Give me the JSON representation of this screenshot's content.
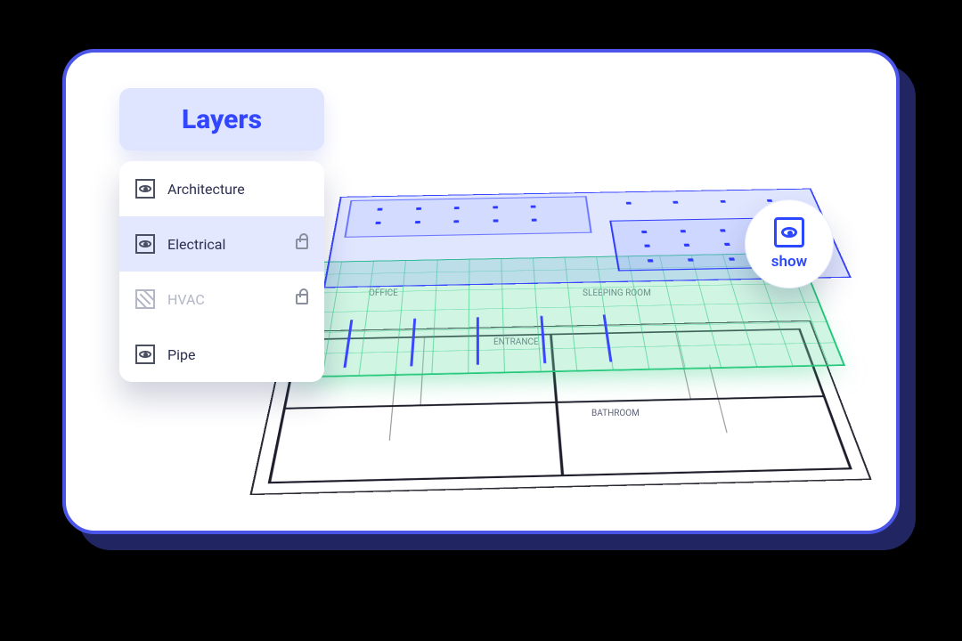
{
  "panel": {
    "title": "Layers",
    "items": [
      {
        "label": "Architecture",
        "visible": true,
        "locked": false,
        "muted": false,
        "selected": false
      },
      {
        "label": "Electrical",
        "visible": true,
        "locked": true,
        "muted": false,
        "selected": true
      },
      {
        "label": "HVAC",
        "visible": false,
        "locked": true,
        "muted": true,
        "selected": false
      },
      {
        "label": "Pipe",
        "visible": true,
        "locked": false,
        "muted": false,
        "selected": false
      }
    ]
  },
  "show_badge": {
    "label": "show"
  },
  "floor": {
    "rooms": {
      "office": "OFFICE",
      "sleeping": "SLEEPING ROOM",
      "entrance": "ENTRANCE",
      "bathroom": "BATHROOM"
    }
  },
  "colors": {
    "brand": "#3346ff",
    "accent_green": "#22c879",
    "accent_blue": "#3a46ff",
    "muted": "#b2b6c6"
  }
}
